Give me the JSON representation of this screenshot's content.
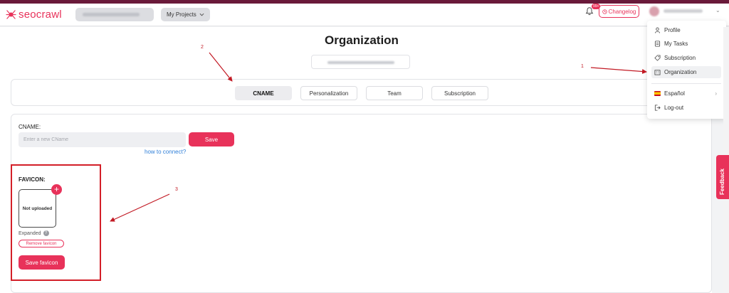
{
  "brand": {
    "name": "seocrawl",
    "accent": "#e8325a"
  },
  "topbar": {
    "projects_label": "My Projects",
    "notification_badge": "99+",
    "changelog_label": "Changelog"
  },
  "page": {
    "title": "Organization"
  },
  "tabs": [
    {
      "label": "CNAME",
      "active": true
    },
    {
      "label": "Personalization",
      "active": false
    },
    {
      "label": "Team",
      "active": false
    },
    {
      "label": "Subscription",
      "active": false
    }
  ],
  "cname": {
    "label": "CNAME:",
    "placeholder": "Enter a new CName",
    "save_label": "Save",
    "help_link": "how to connect?"
  },
  "favicon": {
    "label": "FAVICON:",
    "status": "Not uploaded",
    "add_symbol": "+",
    "expanded_label": "Expanded",
    "help_symbol": "?",
    "remove_label": "Remove favicon",
    "save_label": "Save favicon"
  },
  "user_menu": {
    "items": [
      {
        "label": "Profile",
        "icon": "user-icon"
      },
      {
        "label": "My Tasks",
        "icon": "tasks-icon"
      },
      {
        "label": "Subscription",
        "icon": "tag-icon"
      },
      {
        "label": "Organization",
        "icon": "building-icon",
        "active": true
      }
    ],
    "language": {
      "label": "Español",
      "icon": "spain-flag-icon"
    },
    "logout": {
      "label": "Log-out",
      "icon": "logout-icon"
    }
  },
  "feedback_label": "Feedback",
  "annotations": {
    "one": "1",
    "two": "2",
    "three": "3",
    "color": "#c21a24"
  }
}
